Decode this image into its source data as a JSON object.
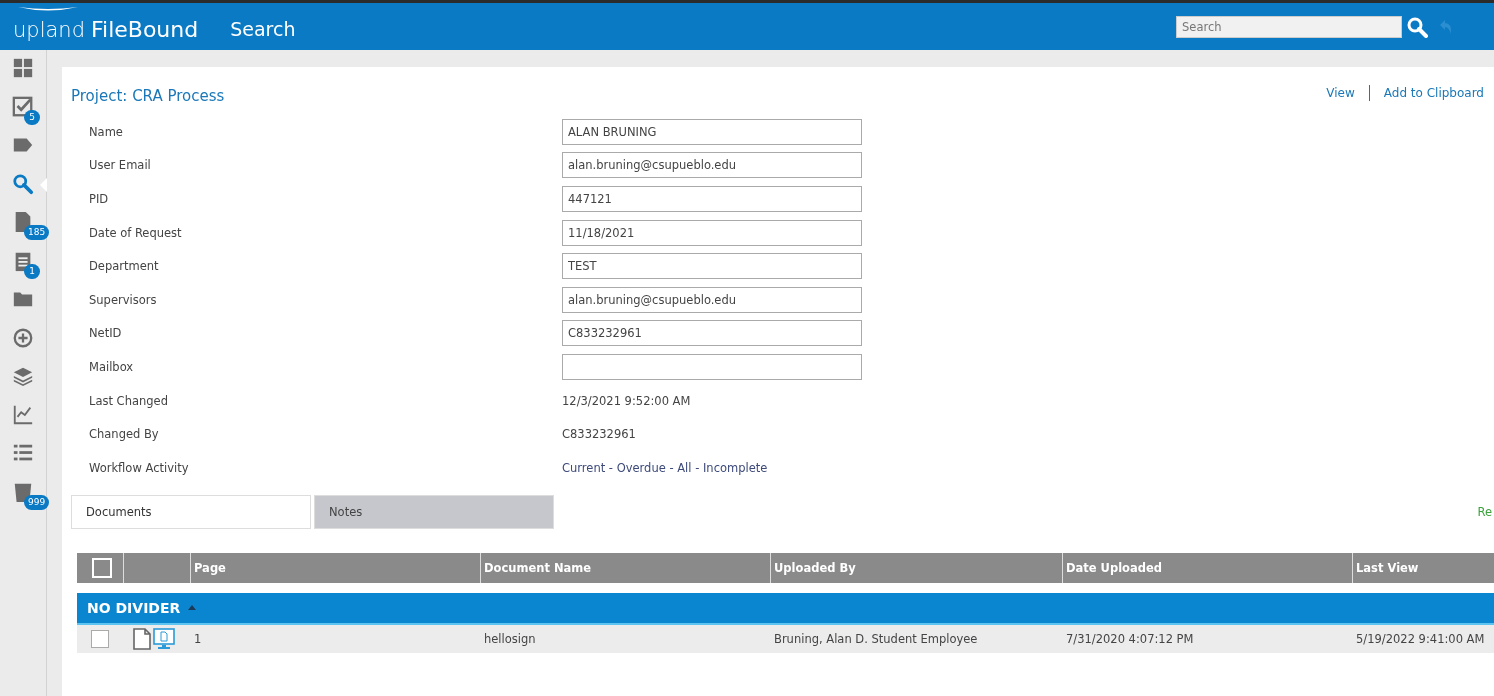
{
  "header": {
    "brand_light": "upland",
    "brand": "FileBound",
    "title": "Search",
    "search": {
      "placeholder": "Search"
    }
  },
  "sidebar": {
    "items": [
      {
        "selected": false
      },
      {
        "selected": false,
        "badge": "5"
      },
      {
        "selected": false
      },
      {
        "selected": true
      },
      {
        "selected": false,
        "badge": "185"
      },
      {
        "selected": false,
        "badge": "1"
      },
      {
        "selected": false
      },
      {
        "selected": false
      },
      {
        "selected": false
      },
      {
        "selected": false
      },
      {
        "selected": false
      },
      {
        "selected": false,
        "badge": "999"
      }
    ]
  },
  "project": {
    "title": "Project: CRA Process",
    "actions": [
      "View",
      "Add to Clipboard"
    ],
    "fields": [
      {
        "label": "Name",
        "kind": "input",
        "value": "ALAN BRUNING"
      },
      {
        "label": "User Email",
        "kind": "input",
        "value": "alan.bruning@csupueblo.edu"
      },
      {
        "label": "PID",
        "kind": "input",
        "value": "447121"
      },
      {
        "label": "Date of Request",
        "kind": "input",
        "value": "11/18/2021"
      },
      {
        "label": "Department",
        "kind": "input",
        "value": "TEST"
      },
      {
        "label": "Supervisors",
        "kind": "input",
        "value": "alan.bruning@csupueblo.edu"
      },
      {
        "label": "NetID",
        "kind": "input",
        "value": "C833232961"
      },
      {
        "label": "Mailbox",
        "kind": "input"
      },
      {
        "label": "Last Changed",
        "kind": "text",
        "value": "12/3/2021 9:52:00 AM"
      },
      {
        "label": "Changed By",
        "kind": "text",
        "value": "C833232961"
      },
      {
        "label": "Workflow Activity",
        "kind": "link",
        "value": "Current - Overdue - All - Incomplete"
      }
    ]
  },
  "tabs": [
    {
      "label": "Documents",
      "selected": true
    },
    {
      "label": "Notes",
      "selected": false
    }
  ],
  "side_link": "Re",
  "table": {
    "select_all": {
      "checked": false
    },
    "columns": [
      "Page",
      "Document Name",
      "Uploaded By",
      "Date Uploaded",
      "Last View"
    ],
    "group": {
      "label": "NO DIVIDER",
      "expanded": true
    },
    "rows": [
      {
        "checked": false,
        "cells": [
          "1",
          "hellosign",
          "Bruning, Alan D. Student Employee",
          "7/31/2020 4:07:12 PM",
          "5/19/2022 9:41:00 AM"
        ]
      }
    ]
  }
}
